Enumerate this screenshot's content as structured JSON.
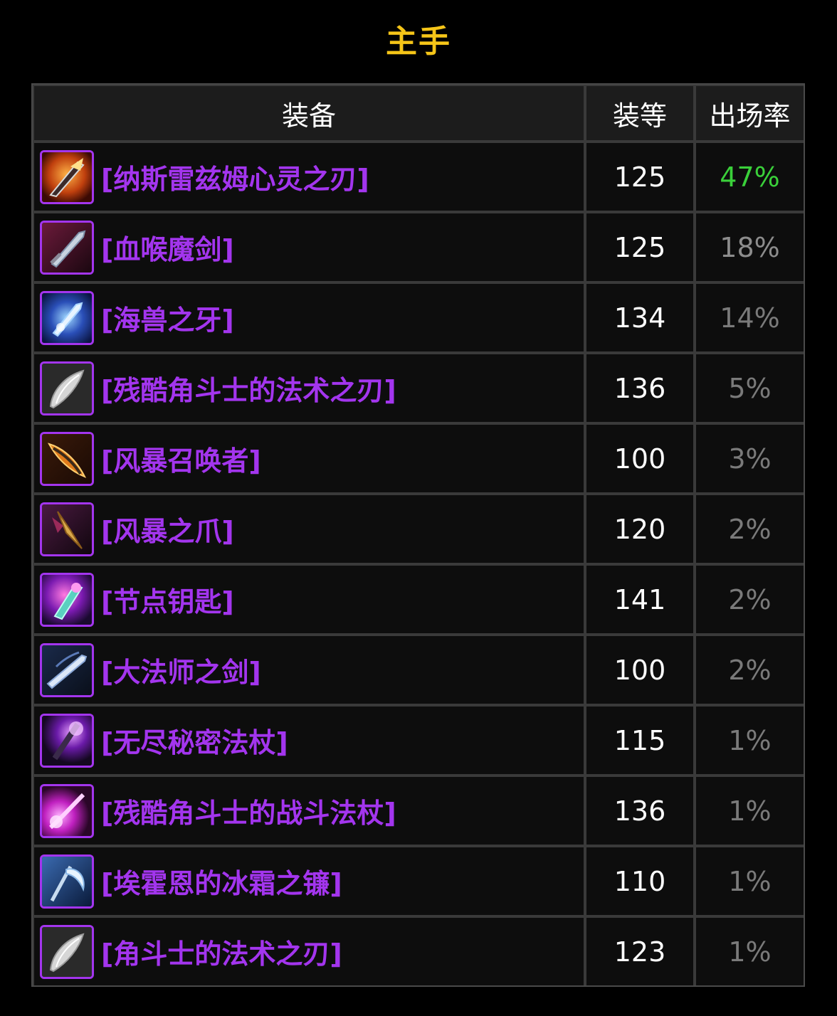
{
  "title": "主手",
  "headers": {
    "item": "装备",
    "ilvl": "装等",
    "rate": "出场率"
  },
  "rows": [
    {
      "name": "[纳斯雷兹姆心灵之刃]",
      "ilvl": "125",
      "rate": "47%",
      "rate_color": "#3ad03a",
      "icon": "flaming-blade-icon"
    },
    {
      "name": "[血喉魔剑]",
      "ilvl": "125",
      "rate": "18%",
      "rate_color": "#8c8c8c",
      "icon": "fel-sword-icon"
    },
    {
      "name": "[海兽之牙]",
      "ilvl": "134",
      "rate": "14%",
      "rate_color": "#7a7a7a",
      "icon": "ice-fang-icon"
    },
    {
      "name": "[残酷角斗士的法术之刃]",
      "ilvl": "136",
      "rate": "5%",
      "rate_color": "#7a7a7a",
      "icon": "curved-blade-icon"
    },
    {
      "name": "[风暴召唤者]",
      "ilvl": "100",
      "rate": "3%",
      "rate_color": "#7a7a7a",
      "icon": "fire-dagger-icon"
    },
    {
      "name": "[风暴之爪]",
      "ilvl": "120",
      "rate": "2%",
      "rate_color": "#7a7a7a",
      "icon": "claw-dagger-icon"
    },
    {
      "name": "[节点钥匙]",
      "ilvl": "141",
      "rate": "2%",
      "rate_color": "#7a7a7a",
      "icon": "crystal-key-icon"
    },
    {
      "name": "[大法师之剑]",
      "ilvl": "100",
      "rate": "2%",
      "rate_color": "#7a7a7a",
      "icon": "archmage-sword-icon"
    },
    {
      "name": "[无尽秘密法杖]",
      "ilvl": "115",
      "rate": "1%",
      "rate_color": "#7a7a7a",
      "icon": "arcane-staff-icon"
    },
    {
      "name": "[残酷角斗士的战斗法杖]",
      "ilvl": "136",
      "rate": "1%",
      "rate_color": "#7a7a7a",
      "icon": "pink-staff-icon"
    },
    {
      "name": "[埃霍恩的冰霜之镰]",
      "ilvl": "110",
      "rate": "1%",
      "rate_color": "#7a7a7a",
      "icon": "frost-scythe-icon"
    },
    {
      "name": "[角斗士的法术之刃]",
      "ilvl": "123",
      "rate": "1%",
      "rate_color": "#7a7a7a",
      "icon": "curved-blade-icon"
    }
  ]
}
